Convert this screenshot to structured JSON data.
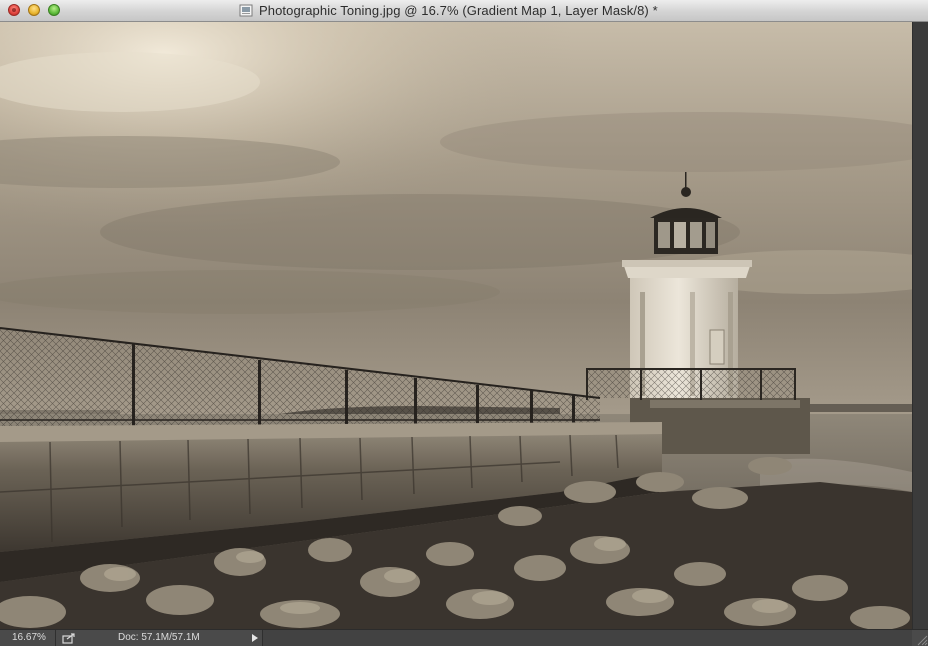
{
  "window": {
    "title": "Photographic Toning.jpg @ 16.7% (Gradient Map 1, Layer Mask/8) *",
    "title_icon": "document-icon"
  },
  "canvas": {
    "image_tint": "#a59a88"
  },
  "statusbar": {
    "zoom": "16.67%",
    "doc_info": "Doc: 57.1M/57.1M",
    "share_icon": "share-icon",
    "info_arrow_icon": "triangle-right-icon"
  },
  "colors": {
    "titlebar": "#d4d4d4",
    "statusbar": "#4a4a4a",
    "scrollbar": "#3b3b3b"
  }
}
